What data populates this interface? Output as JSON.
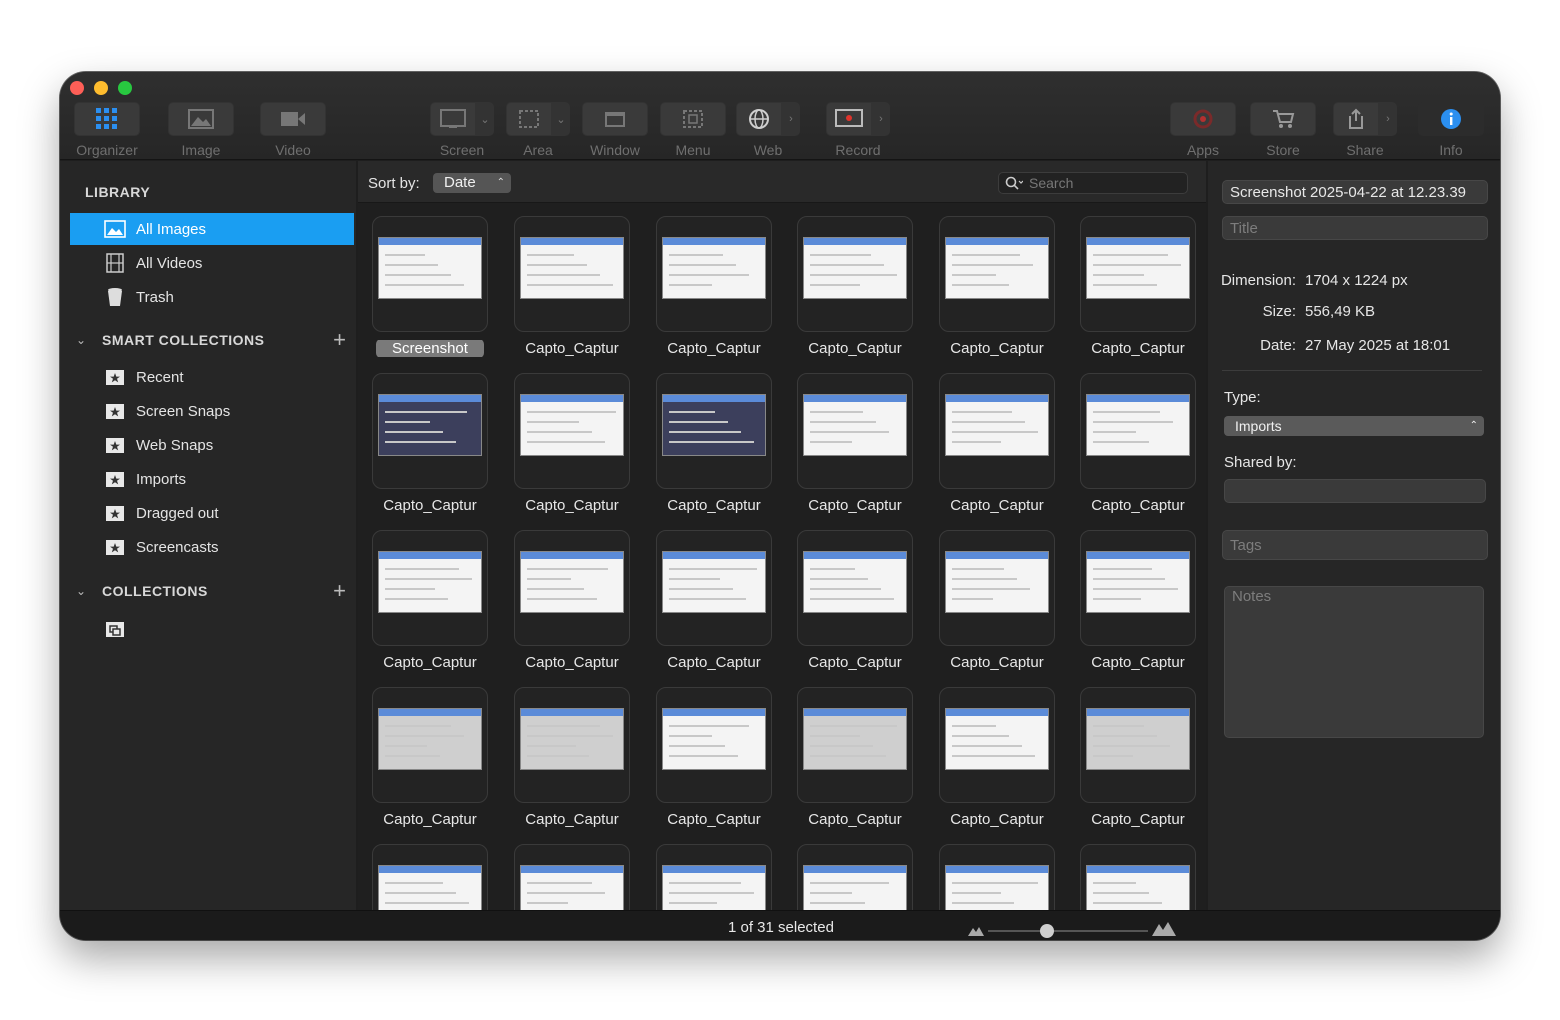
{
  "toolbar": {
    "items": [
      {
        "label": "Organizer",
        "icon": "grid-icon"
      },
      {
        "label": "Image",
        "icon": "image-icon"
      },
      {
        "label": "Video",
        "icon": "video-icon"
      },
      {
        "label": "Screen",
        "icon": "screen-icon"
      },
      {
        "label": "Area",
        "icon": "area-icon"
      },
      {
        "label": "Window",
        "icon": "window-icon"
      },
      {
        "label": "Menu",
        "icon": "menu-icon"
      },
      {
        "label": "Web",
        "icon": "globe-icon"
      },
      {
        "label": "Record",
        "icon": "record-icon"
      },
      {
        "label": "Apps",
        "icon": "apps-icon"
      },
      {
        "label": "Store",
        "icon": "cart-icon"
      },
      {
        "label": "Share",
        "icon": "share-icon"
      },
      {
        "label": "Info",
        "icon": "info-icon"
      }
    ],
    "accent": "#1a9ef2"
  },
  "sidebar": {
    "library_heading": "LIBRARY",
    "library_items": [
      {
        "label": "All Images",
        "icon": "image-icon",
        "selected": true
      },
      {
        "label": "All Videos",
        "icon": "film-icon",
        "selected": false
      },
      {
        "label": "Trash",
        "icon": "trash-icon",
        "selected": false
      }
    ],
    "smart_heading": "SMART COLLECTIONS",
    "smart_items": [
      {
        "label": "Recent",
        "icon": "star-folder-icon"
      },
      {
        "label": "Screen Snaps",
        "icon": "star-folder-icon"
      },
      {
        "label": "Web Snaps",
        "icon": "star-folder-icon"
      },
      {
        "label": "Imports",
        "icon": "star-folder-icon"
      },
      {
        "label": "Dragged out",
        "icon": "star-folder-icon"
      },
      {
        "label": "Screencasts",
        "icon": "star-folder-icon"
      }
    ],
    "collections_heading": "COLLECTIONS"
  },
  "content": {
    "sort_label": "Sort by:",
    "sort_value": "Date",
    "search_placeholder": "Search",
    "items": [
      {
        "name": "Screenshot",
        "selected": true,
        "style": "light"
      },
      {
        "name": "Capto_Captur",
        "style": "light"
      },
      {
        "name": "Capto_Captur",
        "style": "light"
      },
      {
        "name": "Capto_Captur",
        "style": "light"
      },
      {
        "name": "Capto_Captur",
        "style": "light"
      },
      {
        "name": "Capto_Captur",
        "style": "light"
      },
      {
        "name": "Capto_Captur",
        "style": "dark"
      },
      {
        "name": "Capto_Captur",
        "style": "light"
      },
      {
        "name": "Capto_Captur",
        "style": "dark"
      },
      {
        "name": "Capto_Captur",
        "style": "light"
      },
      {
        "name": "Capto_Captur",
        "style": "light"
      },
      {
        "name": "Capto_Captur",
        "style": "light"
      },
      {
        "name": "Capto_Captur",
        "style": "light"
      },
      {
        "name": "Capto_Captur",
        "style": "light"
      },
      {
        "name": "Capto_Captur",
        "style": "light"
      },
      {
        "name": "Capto_Captur",
        "style": "light"
      },
      {
        "name": "Capto_Captur",
        "style": "light"
      },
      {
        "name": "Capto_Captur",
        "style": "light"
      },
      {
        "name": "Capto_Captur",
        "style": "gray"
      },
      {
        "name": "Capto_Captur",
        "style": "gray"
      },
      {
        "name": "Capto_Captur",
        "style": "light"
      },
      {
        "name": "Capto_Captur",
        "style": "gray"
      },
      {
        "name": "Capto_Captur",
        "style": "light"
      },
      {
        "name": "Capto_Captur",
        "style": "gray"
      },
      {
        "name": "",
        "style": "light"
      },
      {
        "name": "",
        "style": "light"
      },
      {
        "name": "",
        "style": "light"
      },
      {
        "name": "",
        "style": "light"
      },
      {
        "name": "",
        "style": "light"
      },
      {
        "name": "",
        "style": "light"
      }
    ]
  },
  "info": {
    "filename": "Screenshot 2025-04-22 at 12.23.39",
    "title_placeholder": "Title",
    "dimension_label": "Dimension:",
    "dimension_value": "1704 x 1224 px",
    "size_label": "Size:",
    "size_value": "556,49 KB",
    "date_label": "Date:",
    "date_value": "27 May 2025 at 18:01",
    "type_label": "Type:",
    "type_value": "Imports",
    "shared_label": "Shared by:",
    "tags_placeholder": "Tags",
    "notes_placeholder": "Notes"
  },
  "status": {
    "selection_text": "1 of 31 selected"
  }
}
